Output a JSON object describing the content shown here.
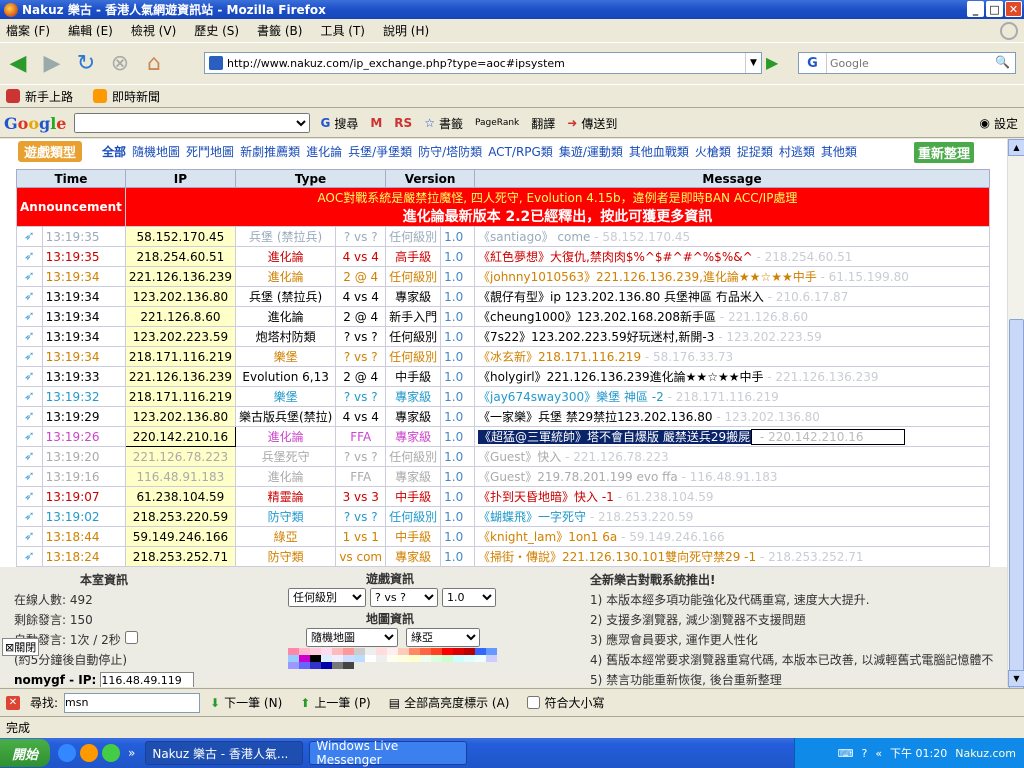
{
  "window": {
    "title": "Nakuz 樂古 - 香港人氣網遊資訊站 - Mozilla Firefox"
  },
  "menu": [
    "檔案 (F)",
    "編輯 (E)",
    "檢視 (V)",
    "歷史 (S)",
    "書籤 (B)",
    "工具 (T)",
    "說明 (H)"
  ],
  "nav": {
    "url": "http://www.nakuz.com/ip_exchange.php?type=aoc#ipsystem",
    "search_placeholder": "Google"
  },
  "bookmarks": [
    "新手上路",
    "即時新聞"
  ],
  "gtoolbar": {
    "logo": "Google",
    "items": [
      "搜尋",
      "RS",
      "書籤",
      "PageRank",
      "翻譯",
      "傳送到",
      "設定"
    ]
  },
  "game_bar": {
    "title": "遊戲類型",
    "categories": [
      "全部",
      "隨機地圖",
      "死鬥地圖",
      "新劇推薦類",
      "進化論",
      "兵堡/爭堡類",
      "防守/塔防類",
      "ACT/RPG類",
      "集遊/運動類",
      "其他血戰類",
      "火槍類",
      "捉捉類",
      "村逃類",
      "其他類"
    ],
    "refresh": "重新整理"
  },
  "table": {
    "headers": [
      "Time",
      "IP",
      "Type",
      "Version",
      "Message"
    ],
    "announcement_label": "Announcement",
    "announcement_line1": "AOC對戰系統是嚴禁拉魔怪, 四人死守, Evolution 4.15b，違例者是即時BAN ACC/IP處理",
    "announcement_line2": "進化論最新版本 2.2已經釋出，按此可獲更多資訊",
    "rows": [
      {
        "time": "13:19:35",
        "ip": "58.152.170.45",
        "type": "兵堡 (禁拉兵)",
        "mode": "? vs ?",
        "level": "任何級別",
        "ver": "1.0",
        "msg": "《santiago》 come",
        "ghost": " - 58.152.170.45",
        "color": "light"
      },
      {
        "time": "13:19:35",
        "ip": "218.254.60.51",
        "type": "進化論",
        "mode": "4 vs 4",
        "level": "高手級",
        "ver": "1.0",
        "msg": "《紅色夢想》大復仇,禁肉肉$%^$#^#^%$%&^",
        "ghost": " - 218.254.60.51",
        "color": "red"
      },
      {
        "time": "13:19:34",
        "ip": "221.126.136.239",
        "type": "進化論",
        "mode": "2 @ 4",
        "level": "任何級別",
        "ver": "1.0",
        "msg": "《johnny1010563》221.126.136.239,進化論★★☆★★中手",
        "ghost": " - 61.15.199.80",
        "color": "orange"
      },
      {
        "time": "13:19:34",
        "ip": "123.202.136.80",
        "type": "兵堡 (禁拉兵)",
        "mode": "4 vs 4",
        "level": "專家級",
        "ver": "1.0",
        "msg": "《靚仔有型》ip 123.202.136.80 兵堡神區 冇品米入",
        "ghost": " - 210.6.17.87",
        "color": "black"
      },
      {
        "time": "13:19:34",
        "ip": "221.126.8.60",
        "type": "進化論",
        "mode": "2 @ 4",
        "level": "新手入門",
        "ver": "1.0",
        "msg": "《cheung1000》123.202.168.208新手區",
        "ghost": " - 221.126.8.60",
        "color": "black"
      },
      {
        "time": "13:19:34",
        "ip": "123.202.223.59",
        "type": "炮塔村防類",
        "mode": "? vs ?",
        "level": "任何級別",
        "ver": "1.0",
        "msg": "《7s22》123.202.223.59好玩迷村,新開-3",
        "ghost": " - 123.202.223.59",
        "color": "black"
      },
      {
        "time": "13:19:34",
        "ip": "218.171.116.219",
        "type": "樂堡",
        "mode": "? vs ?",
        "level": "任何級別",
        "ver": "1.0",
        "msg": "《冰玄新》218.171.116.219",
        "ghost": " - 58.176.33.73",
        "color": "orange"
      },
      {
        "time": "13:19:33",
        "ip": "221.126.136.239",
        "type": "Evolution 6,13",
        "mode": "2 @ 4",
        "level": "中手級",
        "ver": "1.0",
        "msg": "《holygirl》221.126.136.239進化論★★☆★★中手",
        "ghost": " - 221.126.136.239",
        "color": "black"
      },
      {
        "time": "13:19:32",
        "ip": "218.171.116.219",
        "type": "樂堡",
        "mode": "? vs ?",
        "level": "專家級",
        "ver": "1.0",
        "msg": "《jay674sway300》樂堡 神區 -2",
        "ghost": " - 218.171.116.219",
        "color": "blue"
      },
      {
        "time": "13:19:29",
        "ip": "123.202.136.80",
        "type": "樂古版兵堡(禁拉)",
        "mode": "4 vs 4",
        "level": "專家級",
        "ver": "1.0",
        "msg": "《一家樂》兵堡 禁29禁拉123.202.136.80",
        "ghost": " - 123.202.136.80",
        "color": "black"
      },
      {
        "time": "13:19:26",
        "ip": "220.142.210.16",
        "type": "進化論",
        "mode": "FFA",
        "level": "專家級",
        "ver": "1.0",
        "msg": "《超猛@三軍統帥》塔不會自爆版 嚴禁送兵29搬屍",
        "ghost": " - 220.142.210.16",
        "color": "magenta",
        "selected": true
      },
      {
        "time": "13:19:20",
        "ip": "221.126.78.223",
        "type": "兵堡死守",
        "mode": "? vs ?",
        "level": "任何級別",
        "ver": "1.0",
        "msg": "《Guest》快入",
        "ghost": " - 221.126.78.223",
        "color": "gray"
      },
      {
        "time": "13:19:16",
        "ip": "116.48.91.183",
        "type": "進化論",
        "mode": "FFA",
        "level": "專家級",
        "ver": "1.0",
        "msg": "《Guest》219.78.201.199 evo ffa",
        "ghost": " - 116.48.91.183",
        "color": "gray"
      },
      {
        "time": "13:19:07",
        "ip": "61.238.104.59",
        "type": "精靈論",
        "mode": "3 vs 3",
        "level": "中手級",
        "ver": "1.0",
        "msg": "《扑到天昏地暗》快入 -1",
        "ghost": " - 61.238.104.59",
        "color": "red"
      },
      {
        "time": "13:19:02",
        "ip": "218.253.220.59",
        "type": "防守類",
        "mode": "? vs ?",
        "level": "任何級別",
        "ver": "1.0",
        "msg": "《蝴蝶飛》一字死守",
        "ghost": " - 218.253.220.59",
        "color": "blue"
      },
      {
        "time": "13:18:44",
        "ip": "59.149.246.166",
        "type": "綠亞",
        "mode": "1 vs 1",
        "level": "中手級",
        "ver": "1.0",
        "msg": "《knight_lam》1on1 6a",
        "ghost": " - 59.149.246.166",
        "color": "orange"
      },
      {
        "time": "13:18:24",
        "ip": "218.253.252.71",
        "type": "防守類",
        "mode": "vs com",
        "level": "專家級",
        "ver": "1.0",
        "msg": "《掃街・傳說》221.126.130.101雙向死守禁29 -1",
        "ghost": " - 218.253.252.71",
        "color": "orange"
      }
    ]
  },
  "room": {
    "title": "本室資訊",
    "online": "在線人數: 492",
    "remaining": "剩餘發言: 150",
    "auto": "自動發言: 1次 / 2秒",
    "auto_note": "(約5分鐘後自動停止)",
    "user_label": "nomygf - IP:",
    "user_ip": "116.48.49.119"
  },
  "game_info": {
    "title": "遊戲資訊",
    "level": "任何級別",
    "mode": "? vs ?",
    "version": "1.0",
    "map_title": "地圖資訊",
    "map": "隨機地圖",
    "map2": "綠亞"
  },
  "news": {
    "title": "全新樂古對戰系統推出!",
    "items": [
      "1) 本版本經多項功能強化及代碼重寫, 速度大大提升.",
      "2) 支援多瀏覽器, 減少瀏覽器不支援問題",
      "3) 應眾會員要求, 運作更人性化",
      "4) 舊版本經常要求瀏覽器重寫代碼, 本版本已改善, 以減輕舊式電腦記憶體不",
      "5) 禁言功能重新恢復, 後台重新整理"
    ]
  },
  "close_label": "關閉",
  "find": {
    "label": "尋找:",
    "value": "msn",
    "next": "下一筆 (N)",
    "prev": "上一筆 (P)",
    "highlight": "全部高亮度標示 (A)",
    "match_case": "符合大小寫"
  },
  "status": "完成",
  "taskbar": {
    "start": "開始",
    "tasks": [
      "Nakuz 樂古 - 香港人氣...",
      "Windows Live Messenger"
    ],
    "clock": "下午 01:20",
    "watermark": "Nakuz.com"
  }
}
